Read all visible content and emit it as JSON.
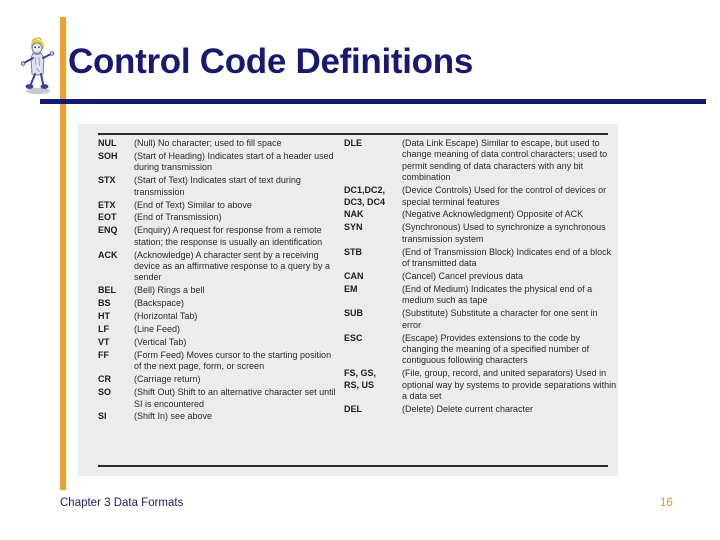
{
  "slide": {
    "title": "Control Code Definitions",
    "accent_color": "#f0a02a",
    "title_color": "#191970",
    "rule_color": "#131a6e",
    "panel_color": "#ececec"
  },
  "clipart": {
    "name": "walking-figure-clipart",
    "hair_color": "#e8d44a",
    "body_color": "#d6dae8",
    "limb_color": "#3b3f9e",
    "shadow_color": "#9a9aa8"
  },
  "table": {
    "left_column": [
      {
        "code": "NUL",
        "desc": "(Null) No character; used to fill space"
      },
      {
        "code": "SOH",
        "desc": "(Start of Heading) Indicates start of a header used during transmission"
      },
      {
        "code": "STX",
        "desc": "(Start of Text) Indicates start of text during transmission"
      },
      {
        "code": "ETX",
        "desc": "(End of Text) Similar to above"
      },
      {
        "code": "EOT",
        "desc": "(End of Transmission)"
      },
      {
        "code": "ENQ",
        "desc": "(Enquiry) A request for response from a remote station; the response is usually an identification"
      },
      {
        "code": "ACK",
        "desc": "(Acknowledge) A character sent by a receiving device as an affirmative response to a query by a sender"
      },
      {
        "code": "BEL",
        "desc": "(Bell) Rings a bell"
      },
      {
        "code": "BS",
        "desc": "(Backspace)"
      },
      {
        "code": "HT",
        "desc": "(Horizontal Tab)"
      },
      {
        "code": "LF",
        "desc": "(Line Feed)"
      },
      {
        "code": "VT",
        "desc": "(Vertical Tab)"
      },
      {
        "code": "FF",
        "desc": "(Form Feed) Moves cursor to the starting position of the next page, form, or screen"
      },
      {
        "code": "CR",
        "desc": "(Carriage return)"
      },
      {
        "code": "SO",
        "desc": "(Shift Out) Shift to an alternative character set until SI is encountered"
      },
      {
        "code": "SI",
        "desc": "(Shift In) see above"
      }
    ],
    "right_column": [
      {
        "code": "DLE",
        "desc": "(Data Link Escape) Similar to escape, but used to change meaning of data control characters; used to permit sending of data characters with any bit combination"
      },
      {
        "code": "DC1,DC2,\nDC3, DC4",
        "desc": "(Device Controls) Used for the control of devices or special terminal features"
      },
      {
        "code": "NAK",
        "desc": "(Negative Acknowledgment) Opposite of ACK"
      },
      {
        "code": "SYN",
        "desc": "(Synchronous) Used to synchronize a synchronous transmission system"
      },
      {
        "code": "STB",
        "desc": "(End of Transmission Block) Indicates end of a block of transmitted data"
      },
      {
        "code": "CAN",
        "desc": "(Cancel) Cancel previous data"
      },
      {
        "code": "EM",
        "desc": "(End of Medium) Indicates the physical end of a medium such as tape"
      },
      {
        "code": "SUB",
        "desc": "(Substitute) Substitute a character for one sent in error"
      },
      {
        "code": "ESC",
        "desc": "(Escape) Provides extensions to the code by changing the meaning of a specified number of contiguous following characters"
      },
      {
        "code": "FS, GS,\nRS, US",
        "desc": "(File, group, record, and united separators) Used in optional way by systems to provide separations within a data set"
      },
      {
        "code": "DEL",
        "desc": "(Delete) Delete current character"
      }
    ]
  },
  "footer": {
    "text": "Chapter 3 Data Formats",
    "page_number": "16",
    "page_color": "#e09a28"
  }
}
